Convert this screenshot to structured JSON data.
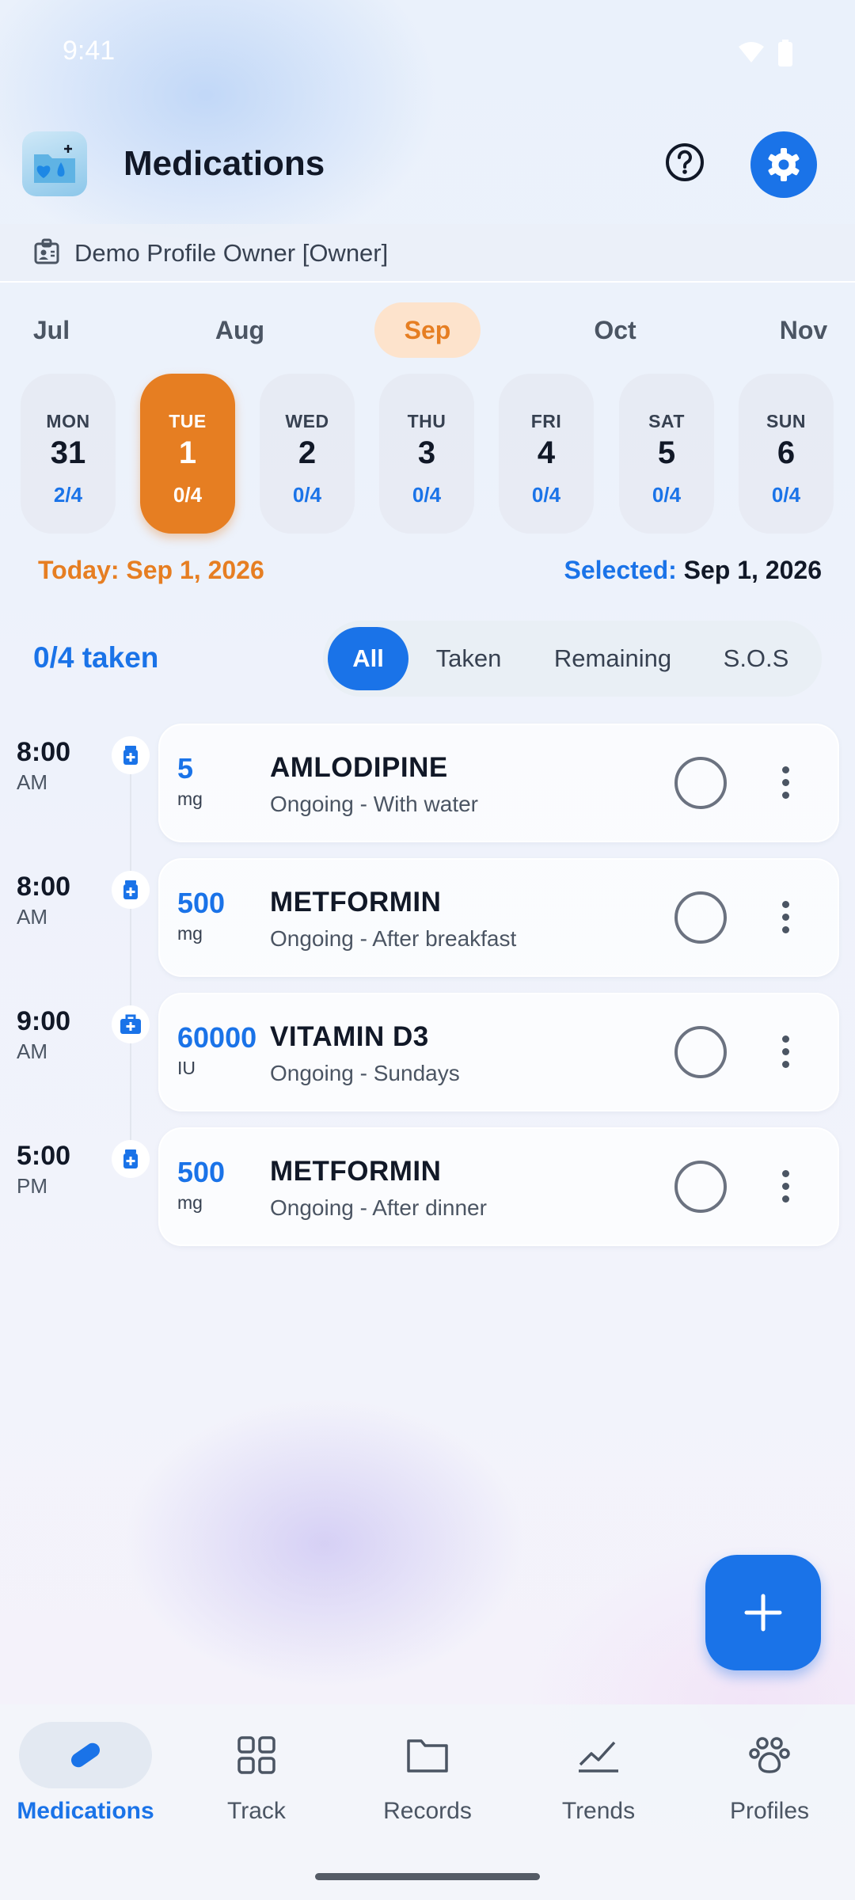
{
  "status_bar": {
    "time": "9:41"
  },
  "header": {
    "title": "Medications"
  },
  "profile": {
    "name": "Demo Profile Owner [Owner]"
  },
  "months": [
    {
      "label": "Jul"
    },
    {
      "label": "Aug"
    },
    {
      "label": "Sep",
      "active": true
    },
    {
      "label": "Oct"
    },
    {
      "label": "Nov"
    }
  ],
  "days": [
    {
      "name": "MON",
      "date": "31",
      "count": "2/4"
    },
    {
      "name": "TUE",
      "date": "1",
      "count": "0/4",
      "selected": true
    },
    {
      "name": "WED",
      "date": "2",
      "count": "0/4"
    },
    {
      "name": "THU",
      "date": "3",
      "count": "0/4"
    },
    {
      "name": "FRI",
      "date": "4",
      "count": "0/4"
    },
    {
      "name": "SAT",
      "date": "5",
      "count": "0/4"
    },
    {
      "name": "SUN",
      "date": "6",
      "count": "0/4"
    }
  ],
  "today": "Today: Sep 1, 2026",
  "selected": {
    "key": "Selected:",
    "value": "Sep 1, 2026"
  },
  "summary": "0/4 taken",
  "filters": [
    {
      "label": "All",
      "active": true
    },
    {
      "label": "Taken"
    },
    {
      "label": "Remaining"
    },
    {
      "label": "S.O.S"
    }
  ],
  "medications": [
    {
      "time": "8:00",
      "ampm": "AM",
      "dose": "5",
      "unit": "mg",
      "name": "AMLODIPINE",
      "detail": "Ongoing - With water",
      "icon": "pill-bottle-icon"
    },
    {
      "time": "8:00",
      "ampm": "AM",
      "dose": "500",
      "unit": "mg",
      "name": "METFORMIN",
      "detail": "Ongoing - After breakfast",
      "icon": "pill-bottle-icon"
    },
    {
      "time": "9:00",
      "ampm": "AM",
      "dose": "60000",
      "unit": "IU",
      "name": "VITAMIN D3",
      "detail": "Ongoing - Sundays",
      "icon": "medical-kit-icon"
    },
    {
      "time": "5:00",
      "ampm": "PM",
      "dose": "500",
      "unit": "mg",
      "name": "METFORMIN",
      "detail": "Ongoing - After dinner",
      "icon": "pill-bottle-icon"
    }
  ],
  "nav": [
    {
      "label": "Medications",
      "icon": "pill-icon",
      "active": true
    },
    {
      "label": "Track",
      "icon": "grid-icon"
    },
    {
      "label": "Records",
      "icon": "folder-icon"
    },
    {
      "label": "Trends",
      "icon": "trend-icon"
    },
    {
      "label": "Profiles",
      "icon": "paw-icon"
    }
  ],
  "colors": {
    "accent": "#1a73e8",
    "orange": "#e67e22"
  }
}
